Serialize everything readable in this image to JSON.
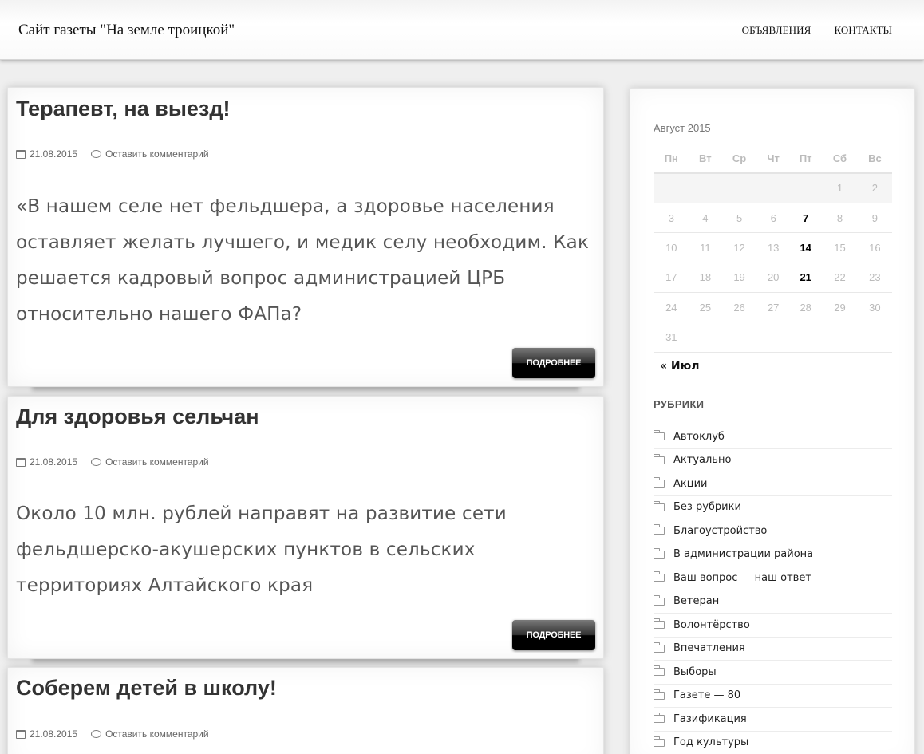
{
  "header": {
    "site_title": "Сайт газеты \"На земле троицкой\"",
    "nav": [
      "ОБЪЯВЛЕНИЯ",
      "КОНТАКТЫ"
    ]
  },
  "posts": [
    {
      "title": "Терапевт, на выезд!",
      "date": "21.08.2015",
      "comment_link": "Оставить комментарий",
      "excerpt": "«В нашем селе нет фельдшера, а здоровье населения оставляет желать лучшего, и медик селу необходим. Как решается кадровый вопрос администрацией ЦРБ относительно нашего ФАПа?",
      "more_label": "ПОДРОБНЕЕ"
    },
    {
      "title": "Для здоровья сельчан",
      "date": "21.08.2015",
      "comment_link": "Оставить комментарий",
      "excerpt": "Около 10 млн. рублей направят на развитие сети фельдшерско-акушерских пунктов в сельских территориях Алтайского края",
      "more_label": "ПОДРОБНЕЕ"
    },
    {
      "title": "Соберем детей в школу!",
      "date": "21.08.2015",
      "comment_link": "Оставить комментарий"
    }
  ],
  "calendar": {
    "caption": "Август 2015",
    "weekdays": [
      "Пн",
      "Вт",
      "Ср",
      "Чт",
      "Пт",
      "Сб",
      "Вс"
    ],
    "weeks": [
      [
        "",
        "",
        "",
        "",
        "",
        "1",
        "2"
      ],
      [
        "3",
        "4",
        "5",
        "6",
        "7",
        "8",
        "9"
      ],
      [
        "10",
        "11",
        "12",
        "13",
        "14",
        "15",
        "16"
      ],
      [
        "17",
        "18",
        "19",
        "20",
        "21",
        "22",
        "23"
      ],
      [
        "24",
        "25",
        "26",
        "27",
        "28",
        "29",
        "30"
      ],
      [
        "31",
        "",
        "",
        "",
        "",
        "",
        ""
      ]
    ],
    "linked_days": [
      "7",
      "14",
      "21"
    ],
    "prev_link": "« Июл"
  },
  "categories": {
    "title": "РУБРИКИ",
    "items": [
      "Автоклуб",
      "Актуально",
      "Акции",
      "Без рубрики",
      "Благоустройство",
      "В администрации района",
      "Ваш вопрос — наш ответ",
      "Ветеран",
      "Волонтёрство",
      "Впечатления",
      "Выборы",
      "Газете — 80",
      "Газификация",
      "Год культуры"
    ]
  },
  "colors": {
    "link_active": "#000000",
    "button_bg": "#000000",
    "button_text": "#ffffff"
  }
}
